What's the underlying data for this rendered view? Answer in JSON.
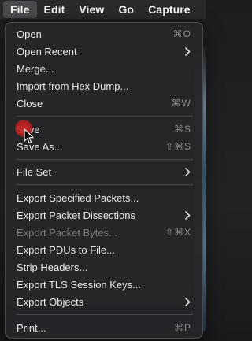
{
  "menubar": {
    "items": [
      {
        "label": "File"
      },
      {
        "label": "Edit"
      },
      {
        "label": "View"
      },
      {
        "label": "Go"
      },
      {
        "label": "Capture"
      }
    ]
  },
  "file_menu": {
    "open": {
      "label": "Open",
      "shortcut": "⌘O"
    },
    "open_recent": {
      "label": "Open Recent",
      "icon": "chevron-right-icon"
    },
    "merge": {
      "label": "Merge..."
    },
    "import_hex": {
      "label": "Import from Hex Dump..."
    },
    "close": {
      "label": "Close",
      "shortcut": "⌘W"
    },
    "save": {
      "label": "Save",
      "shortcut": "⌘S"
    },
    "save_as": {
      "label": "Save As...",
      "shortcut": "⇧⌘S"
    },
    "file_set": {
      "label": "File Set",
      "icon": "chevron-right-icon"
    },
    "export_specified": {
      "label": "Export Specified Packets..."
    },
    "export_dissections": {
      "label": "Export Packet Dissections",
      "icon": "chevron-right-icon"
    },
    "export_bytes": {
      "label": "Export Packet Bytes...",
      "shortcut": "⇧⌘X",
      "disabled": true
    },
    "export_pdus": {
      "label": "Export PDUs to File..."
    },
    "strip_headers": {
      "label": "Strip Headers..."
    },
    "export_tls": {
      "label": "Export TLS Session Keys..."
    },
    "export_objects": {
      "label": "Export Objects",
      "icon": "chevron-right-icon"
    },
    "print": {
      "label": "Print...",
      "shortcut": "⌘P"
    }
  },
  "colors": {
    "menu_bg": "#262629",
    "text": "#e9e9ea",
    "disabled_text": "#7a7a7e",
    "shortcut_text": "#8c8c90",
    "click_marker": "#d72828"
  }
}
